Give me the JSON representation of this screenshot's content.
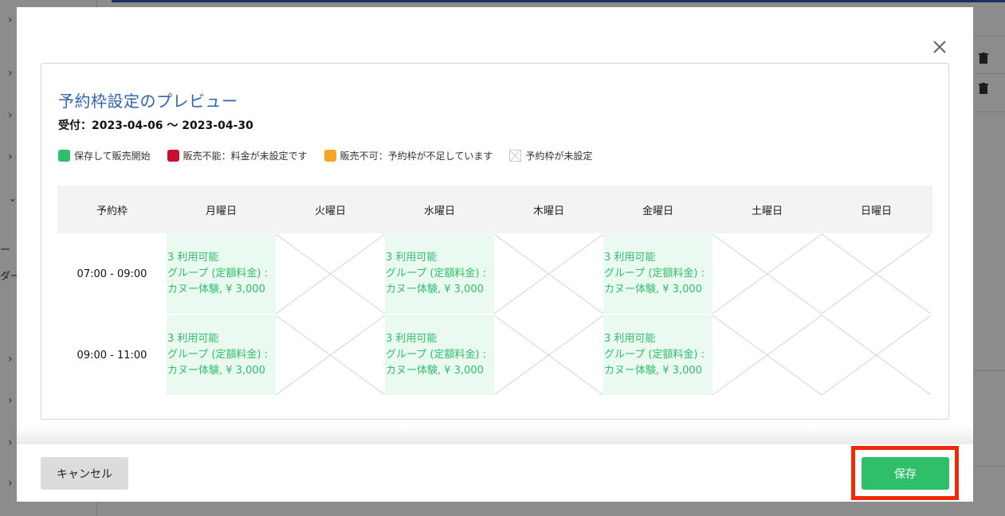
{
  "background": {
    "side_texts": [
      "ー",
      "ダー"
    ]
  },
  "modal": {
    "title": "予約枠設定のプレビュー",
    "period": "受付：2023-04-06 ～ 2023-04-30",
    "legend": [
      {
        "color": "#2fbf6b",
        "label": "保存して販売開始",
        "icon": "green-square"
      },
      {
        "color": "#c8102e",
        "label": "販売不能：料金が未設定です",
        "icon": "red-square"
      },
      {
        "color": "#f5a623",
        "label": "販売不可：予約枠が不足しています",
        "icon": "orange-square"
      },
      {
        "color": "",
        "label": "予約枠が未設定",
        "icon": "crossed-square"
      }
    ],
    "table": {
      "headers": [
        "予約枠",
        "月曜日",
        "火曜日",
        "水曜日",
        "木曜日",
        "金曜日",
        "土曜日",
        "日曜日"
      ],
      "rows": [
        {
          "time": "07:00 - 09:00",
          "cells": [
            [
              "3 利用可能",
              "グループ (定額料金) :",
              "カヌー体験, ¥ 3,000"
            ],
            null,
            [
              "3 利用可能",
              "グループ (定額料金) :",
              "カヌー体験, ¥ 3,000"
            ],
            null,
            [
              "3 利用可能",
              "グループ (定額料金) :",
              "カヌー体験, ¥ 3,000"
            ],
            null,
            null
          ]
        },
        {
          "time": "09:00 - 11:00",
          "cells": [
            [
              "3 利用可能",
              "グループ (定額料金) :",
              "カヌー体験, ¥ 3,000"
            ],
            null,
            [
              "3 利用可能",
              "グループ (定額料金) :",
              "カヌー体験, ¥ 3,000"
            ],
            null,
            [
              "3 利用可能",
              "グループ (定額料金) :",
              "カヌー体験, ¥ 3,000"
            ],
            null,
            null
          ]
        }
      ]
    },
    "footer": {
      "cancel_label": "キャンセル",
      "save_label": "保存"
    }
  },
  "colors": {
    "accent_title": "#2f63b2",
    "available_text": "#2fbf6b",
    "available_bg": "#eafaf0",
    "save_button": "#2fbf6b",
    "highlight_border": "#f02a07"
  }
}
